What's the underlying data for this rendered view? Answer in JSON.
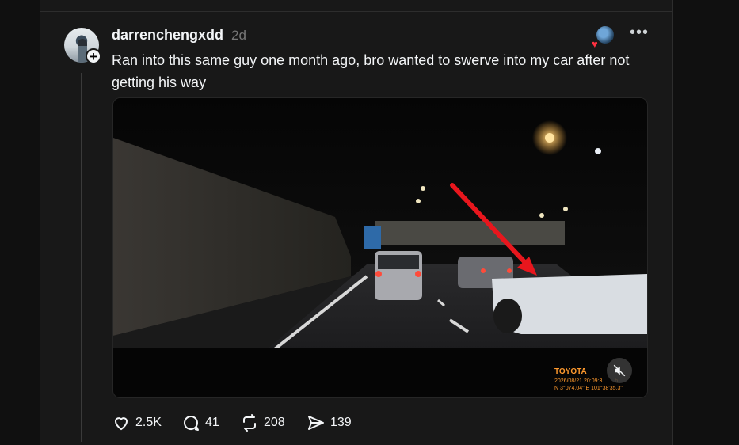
{
  "post": {
    "username": "darrenchengxdd",
    "time": "2d",
    "caption": "Ran into this same guy one month ago, bro wanted to swerve into my car after not getting his way",
    "avatar_icon": "profile-photo",
    "follow_icon": "plus-icon",
    "more_icon": "more-dots-icon"
  },
  "video": {
    "watermark_brand": "TOYOTA",
    "watermark_line1": "2026/08/21 20:09:3… …h",
    "watermark_line2": "N 3°074.04\"  E 101°38'35.3\"",
    "muted": true
  },
  "actions": {
    "likes": "2.5K",
    "comments": "41",
    "reposts": "208",
    "shares": "139"
  },
  "colors": {
    "background": "#101010",
    "panel": "#181818",
    "text": "#f3f5f7",
    "muted_text": "#777777",
    "arrow": "#e8161d"
  }
}
